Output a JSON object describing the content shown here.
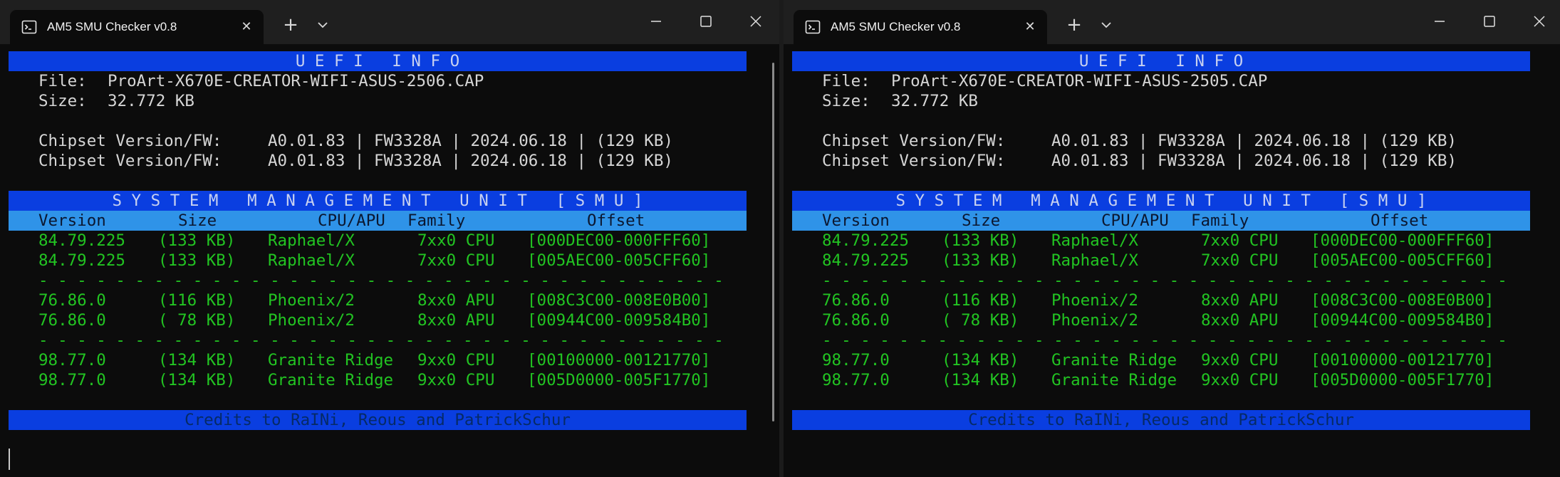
{
  "colors": {
    "header_bar": "#0a3ee0",
    "column_bar": "#2f93e8",
    "green_text": "#22c422",
    "white_text": "#d6d6d6",
    "terminal_bg": "#0c0c0c",
    "titlebar_bg": "#1f1f1f"
  },
  "icons": {
    "tab": "terminal-icon",
    "close": "close-icon",
    "new_tab": "plus-icon",
    "dropdown": "chevron-down-icon",
    "minimize": "minimize-icon",
    "maximize": "maximize-icon",
    "window_close": "close-icon"
  },
  "shared": {
    "tab_title": "AM5 SMU Checker v0.8",
    "tab_close": "✕",
    "new_tab": "+",
    "uefi_header": "U E F I   I N F O",
    "smu_header": "S Y S T E M   M A N A G E M E N T   U N I T   [ S M U ]",
    "file_label": "File:",
    "size_label": "Size:",
    "size_value": "32.772 KB",
    "chipset_label": "Chipset Version/FW:",
    "chipset_value": "A0.01.83 | FW3328A | 2024.06.18 | (129 KB)",
    "columns": {
      "version": "Version",
      "size": "Size",
      "cpu": "CPU/APU",
      "family": "Family",
      "offset": "Offset"
    },
    "separator": "- - - - - - - - - - - - - - - - - - - - - - - - - - - - - - - - - - - -",
    "credits": "Credits to RaINi, Reous and PatrickSchur",
    "smu_groups": [
      [
        {
          "version": "84.79.225",
          "size": "(133 KB)",
          "cpu": "Raphael/X",
          "family": "7xx0 CPU",
          "offset": "[000DEC00-000FFF60]"
        },
        {
          "version": "84.79.225",
          "size": "(133 KB)",
          "cpu": "Raphael/X",
          "family": "7xx0 CPU",
          "offset": "[005AEC00-005CFF60]"
        }
      ],
      [
        {
          "version": "76.86.0",
          "size": "(116 KB)",
          "cpu": "Phoenix/2",
          "family": "8xx0 APU",
          "offset": "[008C3C00-008E0B00]"
        },
        {
          "version": "76.86.0",
          "size": "( 78 KB)",
          "cpu": "Phoenix/2",
          "family": "8xx0 APU",
          "offset": "[00944C00-009584B0]"
        }
      ],
      [
        {
          "version": "98.77.0",
          "size": "(134 KB)",
          "cpu": "Granite Ridge",
          "family": "9xx0 CPU",
          "offset": "[00100000-00121770]"
        },
        {
          "version": "98.77.0",
          "size": "(134 KB)",
          "cpu": "Granite Ridge",
          "family": "9xx0 CPU",
          "offset": "[005D0000-005F1770]"
        }
      ]
    ]
  },
  "windows": [
    {
      "file_name": "ProArt-X670E-CREATOR-WIFI-ASUS-2506.CAP"
    },
    {
      "file_name": "ProArt-X670E-CREATOR-WIFI-ASUS-2505.CAP"
    }
  ]
}
